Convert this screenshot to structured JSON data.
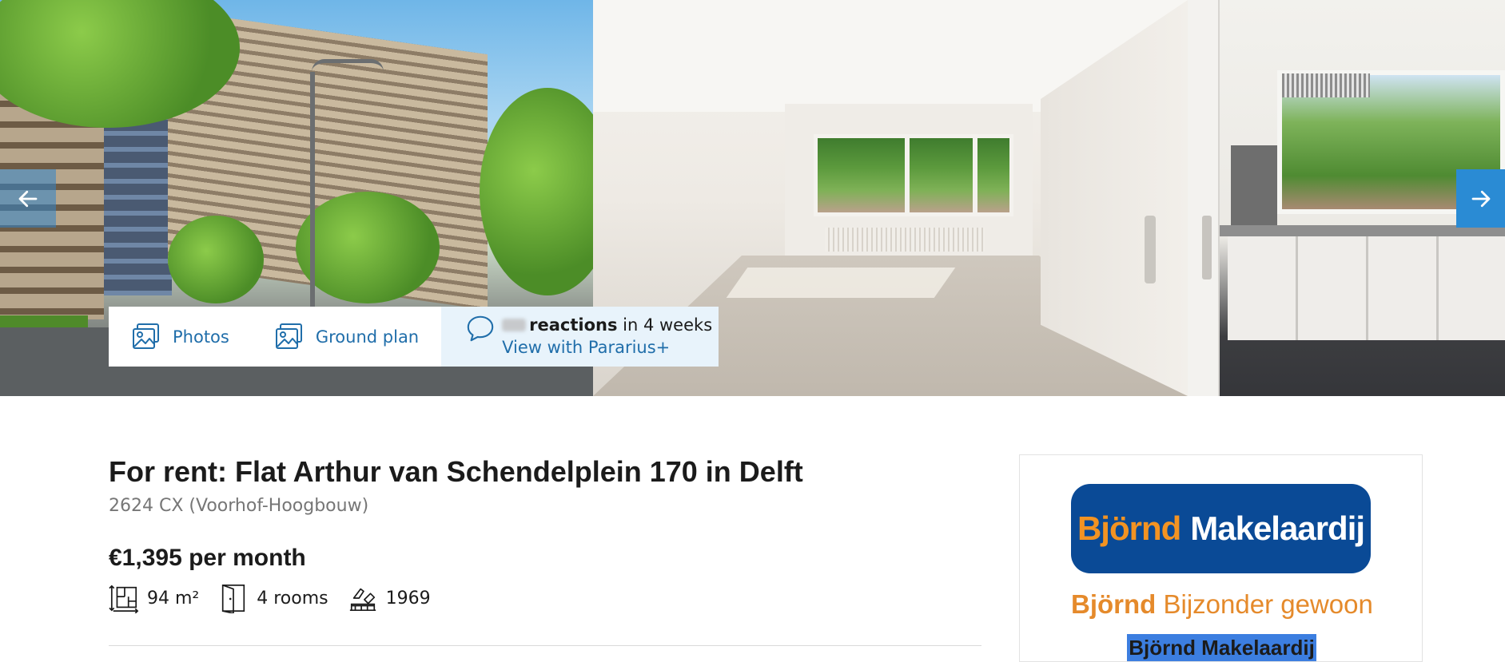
{
  "gallery": {
    "photos": [
      {
        "label": "Exterior of apartment tower"
      },
      {
        "label": "Empty living room with window"
      },
      {
        "label": "Kitchen with window"
      }
    ],
    "prev_icon": "arrow-left-icon",
    "next_icon": "arrow-right-icon"
  },
  "media_actions": {
    "photos_label": "Photos",
    "photos_icon": "image-icon",
    "ground_plan_label": "Ground plan",
    "ground_plan_icon": "floorplan-icon",
    "reactions_icon": "chat-bubble-icon",
    "reactions_label": "reactions",
    "reactions_period": "in 4 weeks",
    "reactions_cta": "View with Pararius+"
  },
  "listing": {
    "title": "For rent: Flat Arthur van Schendelplein 170 in Delft",
    "subtitle": "2624 CX (Voorhof-Hoogbouw)",
    "price": "€1,395 per month",
    "features": [
      {
        "icon": "surface-area-icon",
        "label": "94 m²"
      },
      {
        "icon": "door-icon",
        "label": "4 rooms"
      },
      {
        "icon": "construction-year-icon",
        "label": "1969"
      }
    ]
  },
  "agent": {
    "logo_word_1": "Björnd",
    "logo_word_2": "Makelaardij",
    "slogan_word_1": "Björnd",
    "slogan_rest": "Bijzonder gewoon",
    "name": "Björnd Makelaardij",
    "colors": {
      "logo_background": "#0a4a96",
      "logo_accent": "#f39322",
      "slogan": "#e58a2b"
    }
  },
  "colors": {
    "link": "#206eaa",
    "arrow": "#2a8bd4",
    "reactions_bg": "#e8f3fb"
  }
}
